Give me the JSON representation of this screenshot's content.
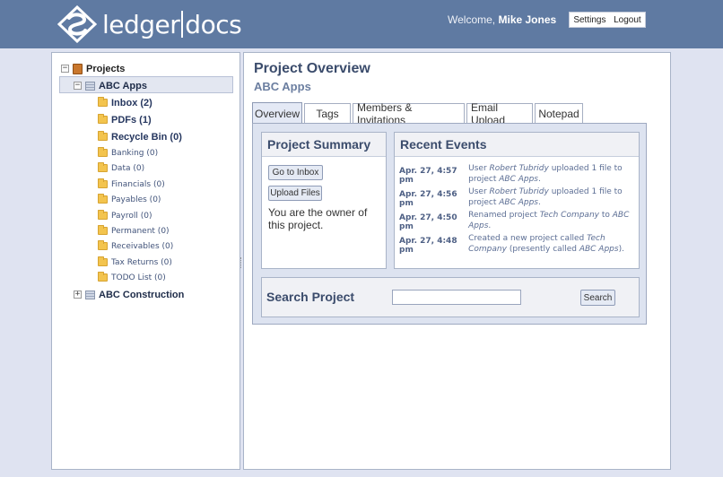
{
  "header": {
    "brand_left": "ledger",
    "brand_right": "docs",
    "welcome_prefix": "Welcome,",
    "user_name": "Mike Jones",
    "settings_label": "Settings",
    "logout_label": "Logout",
    "bg_color": "#5f7aa2"
  },
  "tree": {
    "root": {
      "label": "Projects",
      "expander": "−",
      "icon": "book-icon"
    },
    "projects": [
      {
        "label": "ABC Apps",
        "expander": "−",
        "selected": true,
        "folders": [
          {
            "label": "Inbox (2)",
            "bold": true
          },
          {
            "label": "PDFs (1)",
            "bold": true
          },
          {
            "label": "Recycle Bin (0)",
            "bold": true
          },
          {
            "label": "Banking (0)",
            "bold": false
          },
          {
            "label": "Data (0)",
            "bold": false
          },
          {
            "label": "Financials (0)",
            "bold": false
          },
          {
            "label": "Payables (0)",
            "bold": false
          },
          {
            "label": "Payroll (0)",
            "bold": false
          },
          {
            "label": "Permanent (0)",
            "bold": false
          },
          {
            "label": "Receivables (0)",
            "bold": false
          },
          {
            "label": "Tax Returns (0)",
            "bold": false
          },
          {
            "label": "TODO List (0)",
            "bold": false
          }
        ]
      },
      {
        "label": "ABC Construction",
        "expander": "+",
        "selected": false
      }
    ]
  },
  "main": {
    "title": "Project Overview",
    "subtitle": "ABC Apps",
    "tabs": [
      {
        "label": "Overview",
        "active": true
      },
      {
        "label": "Tags",
        "active": false
      },
      {
        "label": "Members & Invitations",
        "active": false
      },
      {
        "label": "Email Upload",
        "active": false
      },
      {
        "label": "Notepad",
        "active": false
      }
    ],
    "summary": {
      "title": "Project Summary",
      "go_inbox_label": "Go to Inbox",
      "upload_label": "Upload Files",
      "owner_text": "You are the owner of this project."
    },
    "events": {
      "title": "Recent Events",
      "items": [
        {
          "time": "Apr. 27, 4:57 pm",
          "parts": [
            "User ",
            "Robert Tubridy",
            " uploaded 1 file to project ",
            "ABC Apps",
            "."
          ]
        },
        {
          "time": "Apr. 27, 4:56 pm",
          "parts": [
            "User ",
            "Robert Tubridy",
            " uploaded 1 file to project ",
            "ABC Apps",
            "."
          ]
        },
        {
          "time": "Apr. 27, 4:50 pm",
          "parts": [
            "Renamed project ",
            "Tech Company",
            " to ",
            "ABC Apps",
            "."
          ]
        },
        {
          "time": "Apr. 27, 4:48 pm",
          "parts": [
            "Created a new project called ",
            "Tech Company",
            " (presently called ",
            "ABC Apps",
            ")."
          ]
        }
      ]
    },
    "search": {
      "title": "Search Project",
      "input_value": "",
      "button_label": "Search"
    }
  }
}
